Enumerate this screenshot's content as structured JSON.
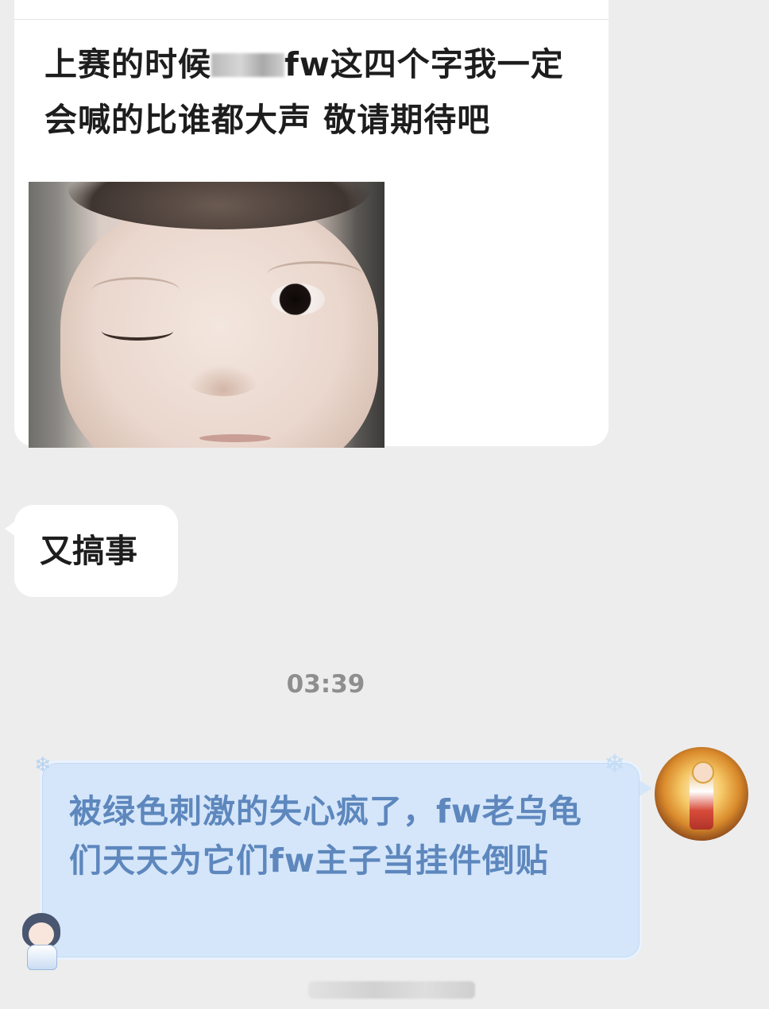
{
  "messages": [
    {
      "id": "msg1",
      "text_before": "上赛的时候",
      "text_after": "fw这四个字我一定会喊的比谁都大声 敬请期待吧",
      "has_redaction": true,
      "image": "baby-winking-photo"
    },
    {
      "id": "msg2",
      "text": "又搞事"
    },
    {
      "id": "msg3",
      "text": "被绿色刺激的失心疯了，fw老乌龟们天天为它们fw主子当挂件倒贴",
      "bubble_color": "#d5e6fa",
      "text_color": "#5d87bd"
    }
  ],
  "timestamp": "03:39",
  "colors": {
    "background": "#ededed",
    "incoming_bubble": "#ffffff"
  },
  "icons": {
    "avatar_right": "golden-character-avatar",
    "bubble_sticker": "chibi-character-sticker",
    "snowflake": "snowflake-icon"
  }
}
